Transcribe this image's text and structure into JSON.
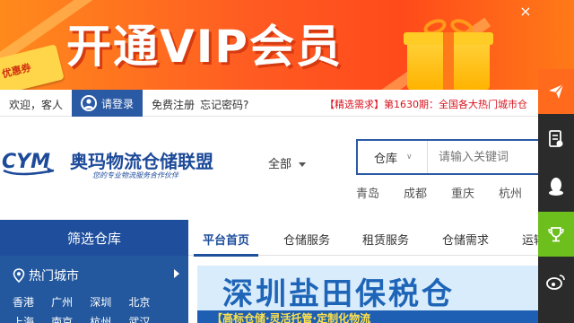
{
  "banner": {
    "vip_text": "开通VIP会员",
    "coupon_label": "优惠券",
    "close_symbol": "×"
  },
  "login_bar": {
    "welcome": "欢迎，客人",
    "login_label": "请登录",
    "register_label": "免费注册",
    "forgot_label": "忘记密码?",
    "news_text": "【精选需求】第1630期：全国各大热门城市仓"
  },
  "logo": {
    "text": "奥玛物流仓储联盟",
    "slogan": "您的专业物流服务合作伙伴",
    "mark": "CYM"
  },
  "search": {
    "category_dropdown": "全部",
    "type_label": "仓库",
    "placeholder": "请输入关键词",
    "hot_cities": [
      "青岛",
      "成都",
      "重庆",
      "杭州"
    ]
  },
  "filter": {
    "title": "筛选仓库",
    "hot_city_label": "热门城市",
    "cities": [
      "香港",
      "广州",
      "深圳",
      "北京",
      "上海",
      "南京",
      "杭州",
      "武汉"
    ]
  },
  "nav": {
    "tabs": [
      "平台首页",
      "仓储服务",
      "租赁服务",
      "仓储需求",
      "运输"
    ],
    "active_index": 0
  },
  "content_banner": {
    "title": "深圳盐田保税仓",
    "subtitle": "【高标仓储·灵活托管·定制化物流"
  },
  "float_bar": {
    "items": [
      "send-icon",
      "document-icon",
      "qq-icon",
      "trophy-icon",
      "weibo-icon"
    ]
  },
  "colors": {
    "brand_blue": "#1e4e9c",
    "banner_orange": "#ff5a22",
    "news_red": "#d7121c",
    "float_orange": "#ff6a1c",
    "float_green": "#6cbf1c"
  }
}
